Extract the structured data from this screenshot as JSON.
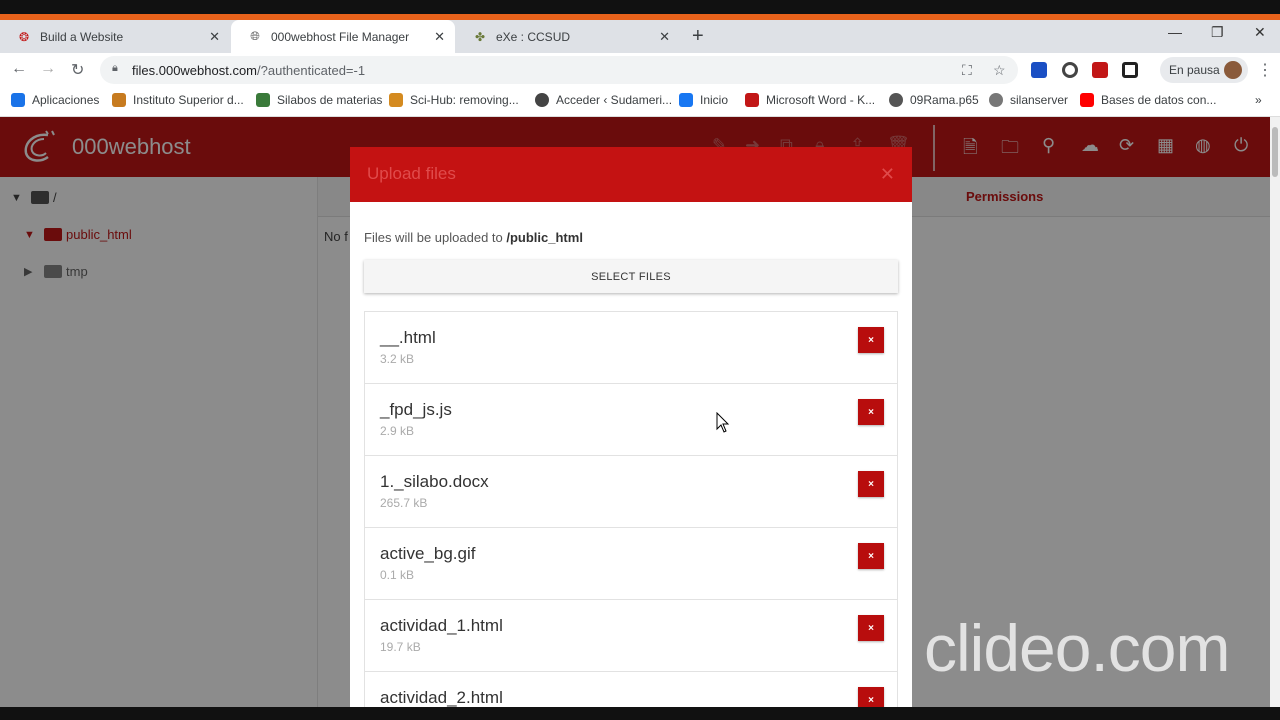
{
  "browser": {
    "tabs": [
      {
        "title": "Build a Website",
        "favicon": "webhost-icon",
        "active": false
      },
      {
        "title": "000webhost File Manager",
        "favicon": "globe-icon",
        "active": true
      },
      {
        "title": "eXe : CCSUD",
        "favicon": "exe-icon",
        "active": false
      }
    ],
    "url_host": "files.000webhost.com",
    "url_path": "/?authenticated=-1",
    "profile_label": "En pausa",
    "bookmarks": [
      {
        "label": "Aplicaciones",
        "icon": "apps-grid-icon",
        "color": "#1a73e8"
      },
      {
        "label": "Instituto Superior d...",
        "icon": "institute-icon",
        "color": "#c77b1f"
      },
      {
        "label": "Silabos de materias",
        "icon": "silabos-icon",
        "color": "#3a7a3a"
      },
      {
        "label": "Sci-Hub: removing...",
        "icon": "scihub-icon",
        "color": "#d48a1f"
      },
      {
        "label": "Acceder ‹ Sudameri...",
        "icon": "wordpress-icon",
        "color": "#444444"
      },
      {
        "label": "Inicio",
        "icon": "facebook-icon",
        "color": "#1877f2"
      },
      {
        "label": "Microsoft Word - K...",
        "icon": "pdf-icon",
        "color": "#c21717"
      },
      {
        "label": "09Rama.p65",
        "icon": "globe-icon",
        "color": "#555555"
      },
      {
        "label": "silanserver",
        "icon": "gear-icon",
        "color": "#777777"
      },
      {
        "label": "Bases de datos con...",
        "icon": "youtube-icon",
        "color": "#ff0000"
      }
    ]
  },
  "app": {
    "brand": "000webhost",
    "tree": {
      "root": "/",
      "items": [
        {
          "label": "public_html",
          "expanded": true
        },
        {
          "label": "tmp",
          "expanded": false
        }
      ]
    },
    "columns": {
      "permissions": "Permissions"
    },
    "empty_text": "No f"
  },
  "modal": {
    "title": "Upload files",
    "note_prefix": "Files will be uploaded to",
    "note_path": "/public_html",
    "select_label": "SELECT FILES",
    "remove_label": "×",
    "files": [
      {
        "name": "__.html",
        "size": "3.2 kB"
      },
      {
        "name": "_fpd_js.js",
        "size": "2.9 kB"
      },
      {
        "name": "1._silabo.docx",
        "size": "265.7 kB"
      },
      {
        "name": "active_bg.gif",
        "size": "0.1 kB"
      },
      {
        "name": "actividad_1.html",
        "size": "19.7 kB"
      },
      {
        "name": "actividad_2.html",
        "size": ""
      }
    ]
  },
  "watermark": "clideo.com",
  "colors": {
    "brand_red": "#c21717",
    "chrome_orange": "#e8621b"
  }
}
